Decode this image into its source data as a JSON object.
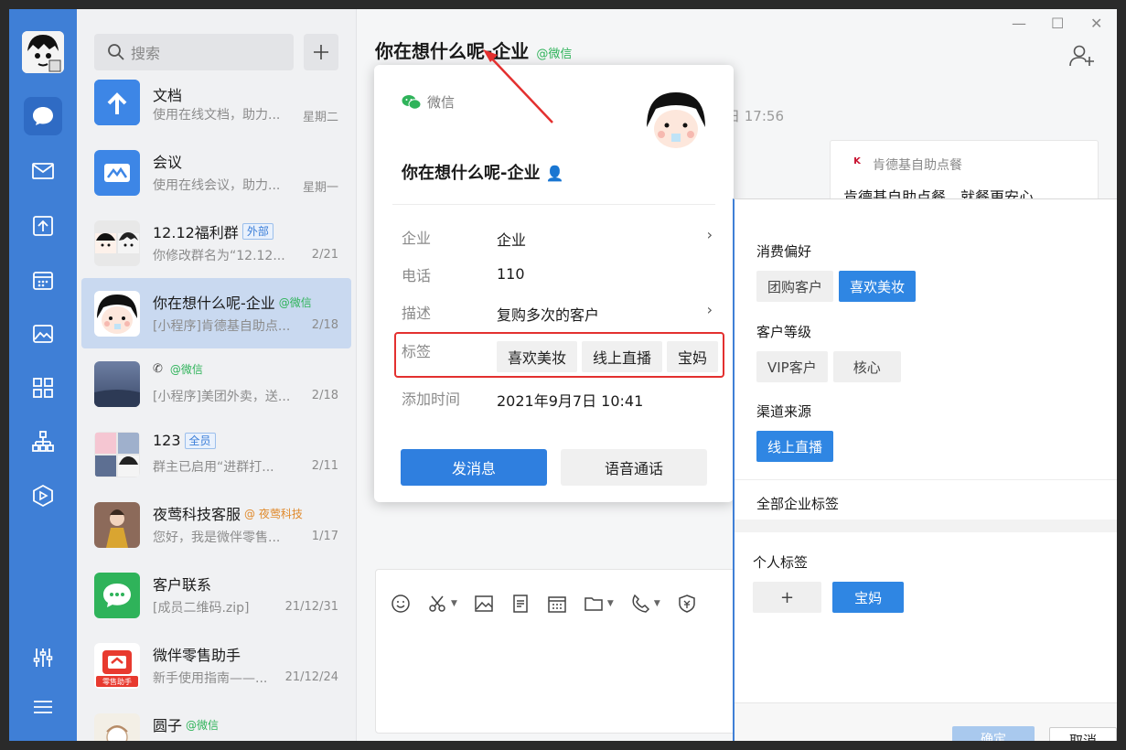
{
  "rail": {
    "items": [
      {
        "name": "chat-icon"
      },
      {
        "name": "mail-icon"
      },
      {
        "name": "docs-icon"
      },
      {
        "name": "calendar-icon"
      },
      {
        "name": "image-icon"
      },
      {
        "name": "apps-icon"
      },
      {
        "name": "org-icon"
      },
      {
        "name": "hex-icon"
      }
    ]
  },
  "search": {
    "placeholder": "搜索"
  },
  "conversations": [
    {
      "name": "文档",
      "preview": "使用在线文档，助力...",
      "time": "星期二"
    },
    {
      "name": "会议",
      "preview": "使用在线会议，助力...",
      "time": "星期一"
    },
    {
      "name": "12.12福利群",
      "badge": "外部",
      "preview": "你修改群名为“12.12...",
      "time": "2/21"
    },
    {
      "name": "你在想什么呢-企业",
      "suffix": "@微信",
      "preview": "[小程序]肯德基自助点...",
      "time": "2/18"
    },
    {
      "name": "",
      "suffix": "@微信",
      "preview": "[小程序]美团外卖，送...",
      "time": "2/18"
    },
    {
      "name": "123",
      "badge": "全员",
      "preview": "群主已启用“进群打...",
      "time": "2/11"
    },
    {
      "name": "夜莺科技客服",
      "suffix": "@ 夜莺科技",
      "preview": "您好，我是微伴零售...",
      "time": "1/17"
    },
    {
      "name": "客户联系",
      "preview": "[成员二维码.zip]",
      "time": "21/12/31"
    },
    {
      "name": "微伴零售助手",
      "preview": "新手使用指南——...",
      "time": "21/12/24",
      "avatar_text": "零售助手"
    },
    {
      "name": "圆子",
      "suffix": "@微信",
      "preview": "",
      "time": ""
    }
  ],
  "chat": {
    "title": "你在想什么呢-企业",
    "title_suffix": "@微信",
    "time": "日 17:56",
    "card": {
      "source": "肯德基自助点餐",
      "text": "肯德基自助点餐，就餐更安心。"
    }
  },
  "profile": {
    "source": "微信",
    "name": "你在想什么呢-企业",
    "rows": {
      "company": {
        "label": "企业",
        "value": "企业"
      },
      "phone": {
        "label": "电话",
        "value": "110"
      },
      "desc": {
        "label": "描述",
        "value": "复购多次的客户"
      },
      "tags": {
        "label": "标签",
        "chips": [
          "喜欢美妆",
          "线上直播",
          "宝妈"
        ]
      },
      "added": {
        "label": "添加时间",
        "value": "2021年9月7日 10:41"
      }
    },
    "send_label": "发消息",
    "call_label": "语音通话"
  },
  "tag_panel": {
    "groups": [
      {
        "title": "消费偏好",
        "chips": [
          {
            "label": "团购客户",
            "on": false
          },
          {
            "label": "喜欢美妆",
            "on": true
          }
        ]
      },
      {
        "title": "客户等级",
        "chips": [
          {
            "label": "VIP客户",
            "on": false
          },
          {
            "label": "核心",
            "on": false
          }
        ]
      },
      {
        "title": "渠道来源",
        "chips": [
          {
            "label": "线上直播",
            "on": true
          }
        ]
      }
    ],
    "all_label": "全部企业标签",
    "personal_title": "个人标签",
    "personal_add": "+",
    "personal_chip": "宝妈",
    "ok_label": "确定",
    "cancel_label": "取消"
  },
  "colors": {
    "rail": "#3f7fd6",
    "primary": "#2f7fdf",
    "highlight": "#e3302f",
    "wechat_green": "#2fb35a"
  }
}
